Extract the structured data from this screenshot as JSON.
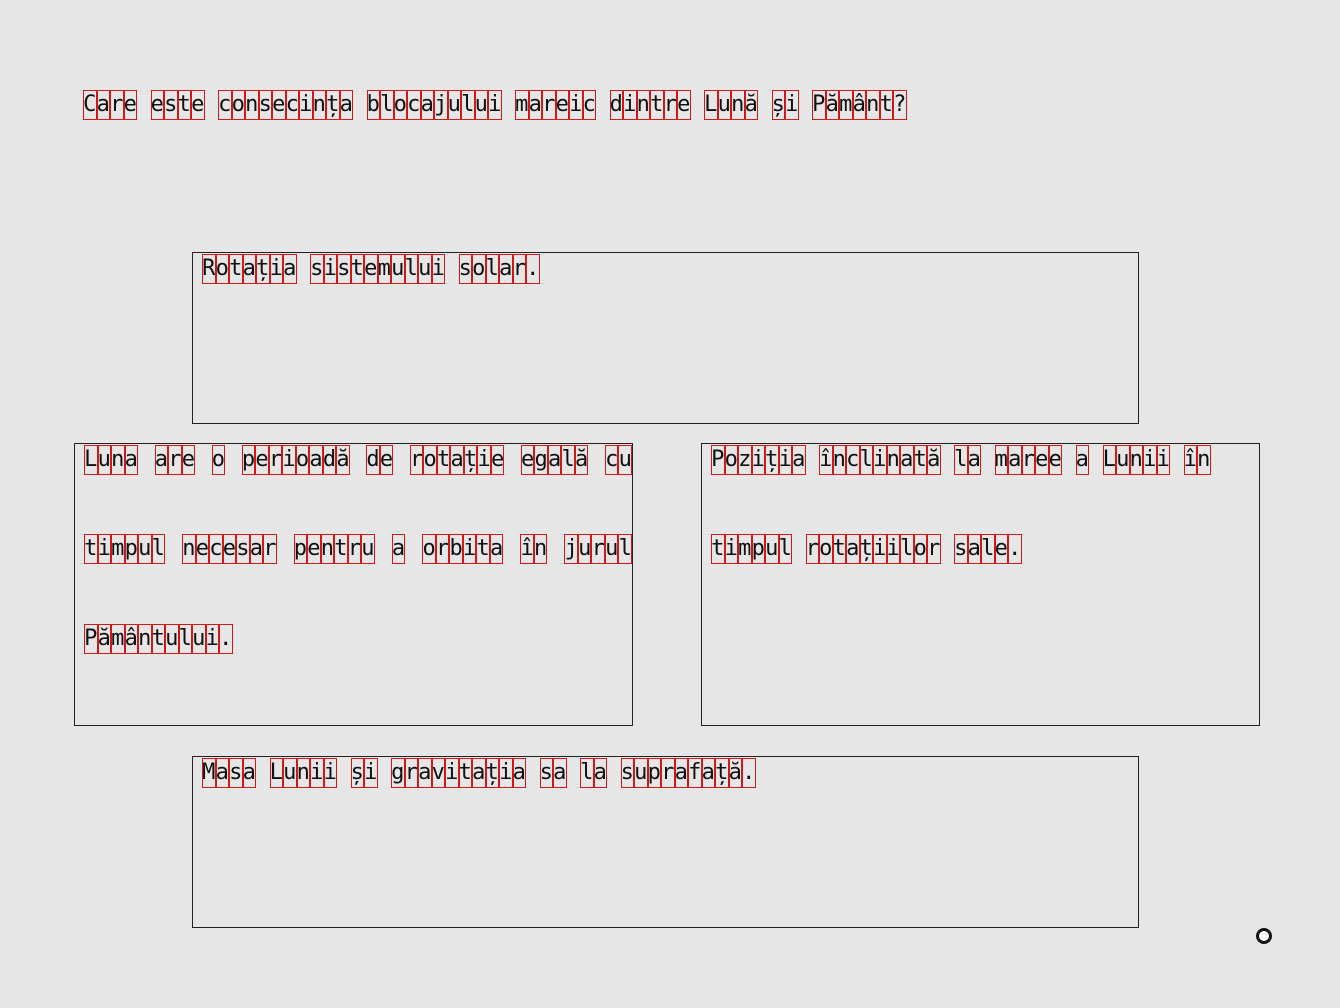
{
  "question": "Care este consecința blocajului mareic dintre Lună și Pământ?",
  "options": [
    {
      "lines": [
        "Rotația sistemului solar."
      ]
    },
    {
      "lines": [
        "Luna are o perioadă de rotație egală cu",
        "timpul necesar pentru a orbita în jurul",
        "Pământului."
      ]
    },
    {
      "lines": [
        "Poziția înclinată la maree a Lunii în",
        "timpul rotațiilor sale."
      ]
    },
    {
      "lines": [
        "Masa Lunii și gravitația sa la suprafață."
      ]
    }
  ],
  "colors": {
    "background": "#e6e6e6",
    "char_box": "#d01818",
    "border": "#222222"
  },
  "icons": {
    "cursor": "mouse-cursor-icon"
  }
}
